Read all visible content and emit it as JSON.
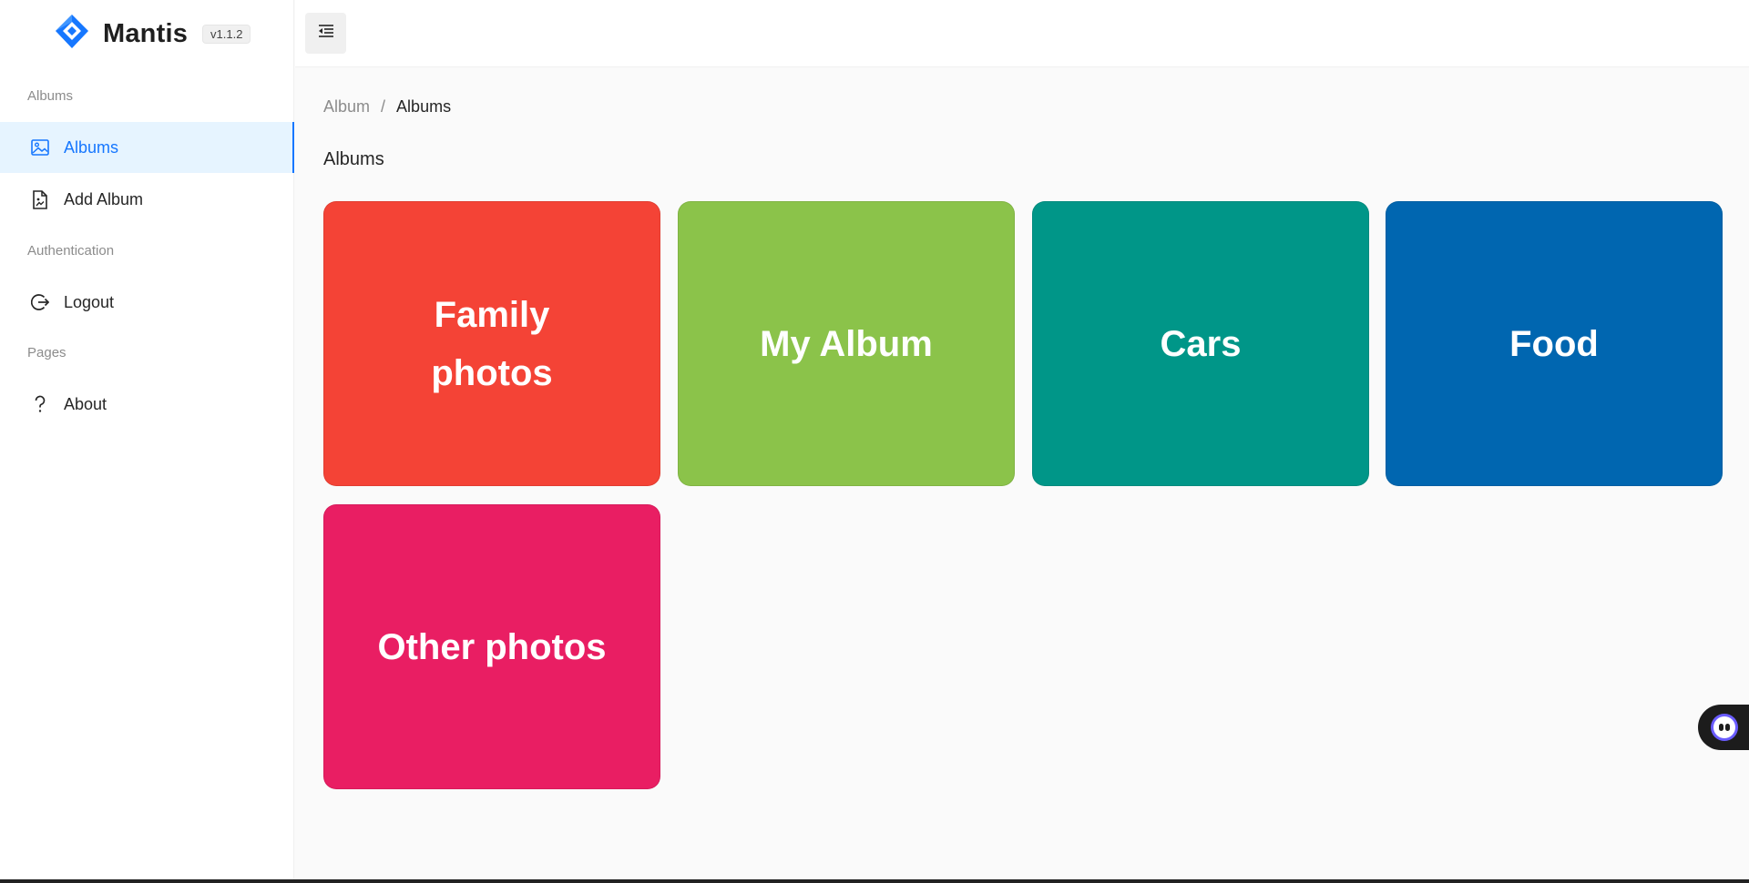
{
  "brand": {
    "name": "Mantis",
    "version": "v1.1.2",
    "color": "#1677ff"
  },
  "sidebar": {
    "groups": [
      {
        "title": "Albums",
        "items": [
          {
            "label": "Albums",
            "icon": "picture-icon",
            "active": true
          },
          {
            "label": "Add Album",
            "icon": "file-image-icon"
          }
        ]
      },
      {
        "title": "Authentication",
        "items": [
          {
            "label": "Logout",
            "icon": "logout-icon"
          }
        ]
      },
      {
        "title": "Pages",
        "items": [
          {
            "label": "About",
            "icon": "question-icon"
          }
        ]
      }
    ]
  },
  "header": {
    "toggle_icon": "menu-fold-icon"
  },
  "breadcrumb": {
    "parent": "Album",
    "separator": "/",
    "current": "Albums"
  },
  "page": {
    "title": "Albums"
  },
  "albums": [
    {
      "title": "Family photos",
      "color": "#f44336"
    },
    {
      "title": "My Album",
      "color": "#8bc34a"
    },
    {
      "title": "Cars",
      "color": "#009688"
    },
    {
      "title": "Food",
      "color": "#0066b0"
    },
    {
      "title": "Other photos",
      "color": "#e91e63"
    }
  ]
}
